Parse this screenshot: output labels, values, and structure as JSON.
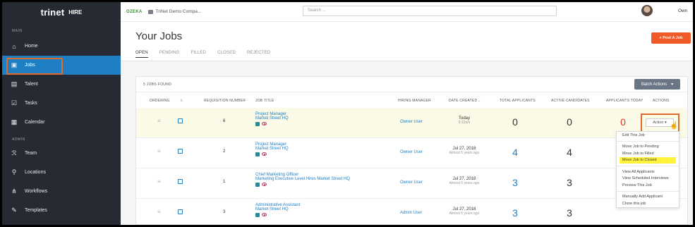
{
  "sidebar": {
    "brand": "trinet",
    "brand_suffix": "HIRE",
    "section_main": "MAIN",
    "section_admin": "ADMIN",
    "main_items": [
      {
        "label": "Home",
        "icon": "home-icon"
      },
      {
        "label": "Jobs",
        "icon": "briefcase-icon",
        "active": true
      },
      {
        "label": "Talent",
        "icon": "id-card-icon"
      },
      {
        "label": "Tasks",
        "icon": "tasks-icon"
      },
      {
        "label": "Calendar",
        "icon": "calendar-icon"
      }
    ],
    "admin_items": [
      {
        "label": "Team",
        "icon": "team-icon"
      },
      {
        "label": "Locations",
        "icon": "location-pin-icon"
      },
      {
        "label": "Workflows",
        "icon": "workflow-icon"
      },
      {
        "label": "Templates",
        "icon": "pencil-icon"
      }
    ]
  },
  "topbar": {
    "company_logo": "OZEKA",
    "company_name": "TriNet Demo Compa...",
    "search_placeholder": "Search ...",
    "user_name": "Own"
  },
  "page": {
    "title": "Your Jobs",
    "post_button": "+ Post A Job",
    "tabs": [
      "OPEN",
      "PENDING",
      "FILLED",
      "CLOSED",
      "REJECTED"
    ],
    "active_tab": "OPEN"
  },
  "table": {
    "jobs_found": "5 JOBS FOUND",
    "batch_actions": "Batch Actions",
    "headers": {
      "ordering": "ORDERING",
      "requisition": "REQUISITION NUMBER",
      "job_title": "JOB TITLE",
      "hiring_manager": "HIRING MANAGER",
      "date_created": "DATE CREATED",
      "total_applicants": "TOTAL APPLICANTS",
      "active_candidates": "ACTIVE CANDIDATES",
      "applicants_today": "APPLICANTS TODAY",
      "actions": "ACTIONS"
    },
    "rows": [
      {
        "req": "6",
        "title": "Project Manager",
        "location": "Market Street HQ",
        "manager": "Owner User",
        "date": "Today",
        "date_sub": "9:22am",
        "total": "0",
        "active": "0",
        "today": "0",
        "action": "Action"
      },
      {
        "req": "2",
        "title": "Project Manager",
        "location": "Market Street HQ",
        "manager": "Owner User",
        "date": "Jul 27, 2018",
        "date_sub": "Almost 5 years ago",
        "total": "4",
        "active": "4",
        "today": ""
      },
      {
        "req": "1",
        "title": "Chief Marketing Officer",
        "location": "Marketing Executive Level Hires Market Street HQ",
        "manager": "Owner User",
        "date": "Jul 27, 2018",
        "date_sub": "Almost 5 years ago",
        "total": "3",
        "active": "3",
        "today": ""
      },
      {
        "req": "3",
        "title": "Administrative Assistant",
        "location": "Market Street HQ",
        "manager": "Admin User",
        "date": "Jul 27, 2018",
        "date_sub": "Almost 5 years ago",
        "total": "3",
        "active": "3",
        "today": ""
      }
    ]
  },
  "dropdown": {
    "items": [
      "Edit This Job",
      "Move Job to Pending",
      "Move Job to Filled",
      "Move Job to Closed",
      "View All Applicants",
      "View Scheduled Interviews",
      "Preview This Job",
      "Manually Add Applicant",
      "Clone this job"
    ]
  },
  "colors": {
    "sidebar_bg": "#262a33",
    "active_blue": "#1f7fc3",
    "accent_orange": "#f05a28",
    "highlight_yellow": "#fff33b",
    "zero_red": "#e0342c"
  }
}
